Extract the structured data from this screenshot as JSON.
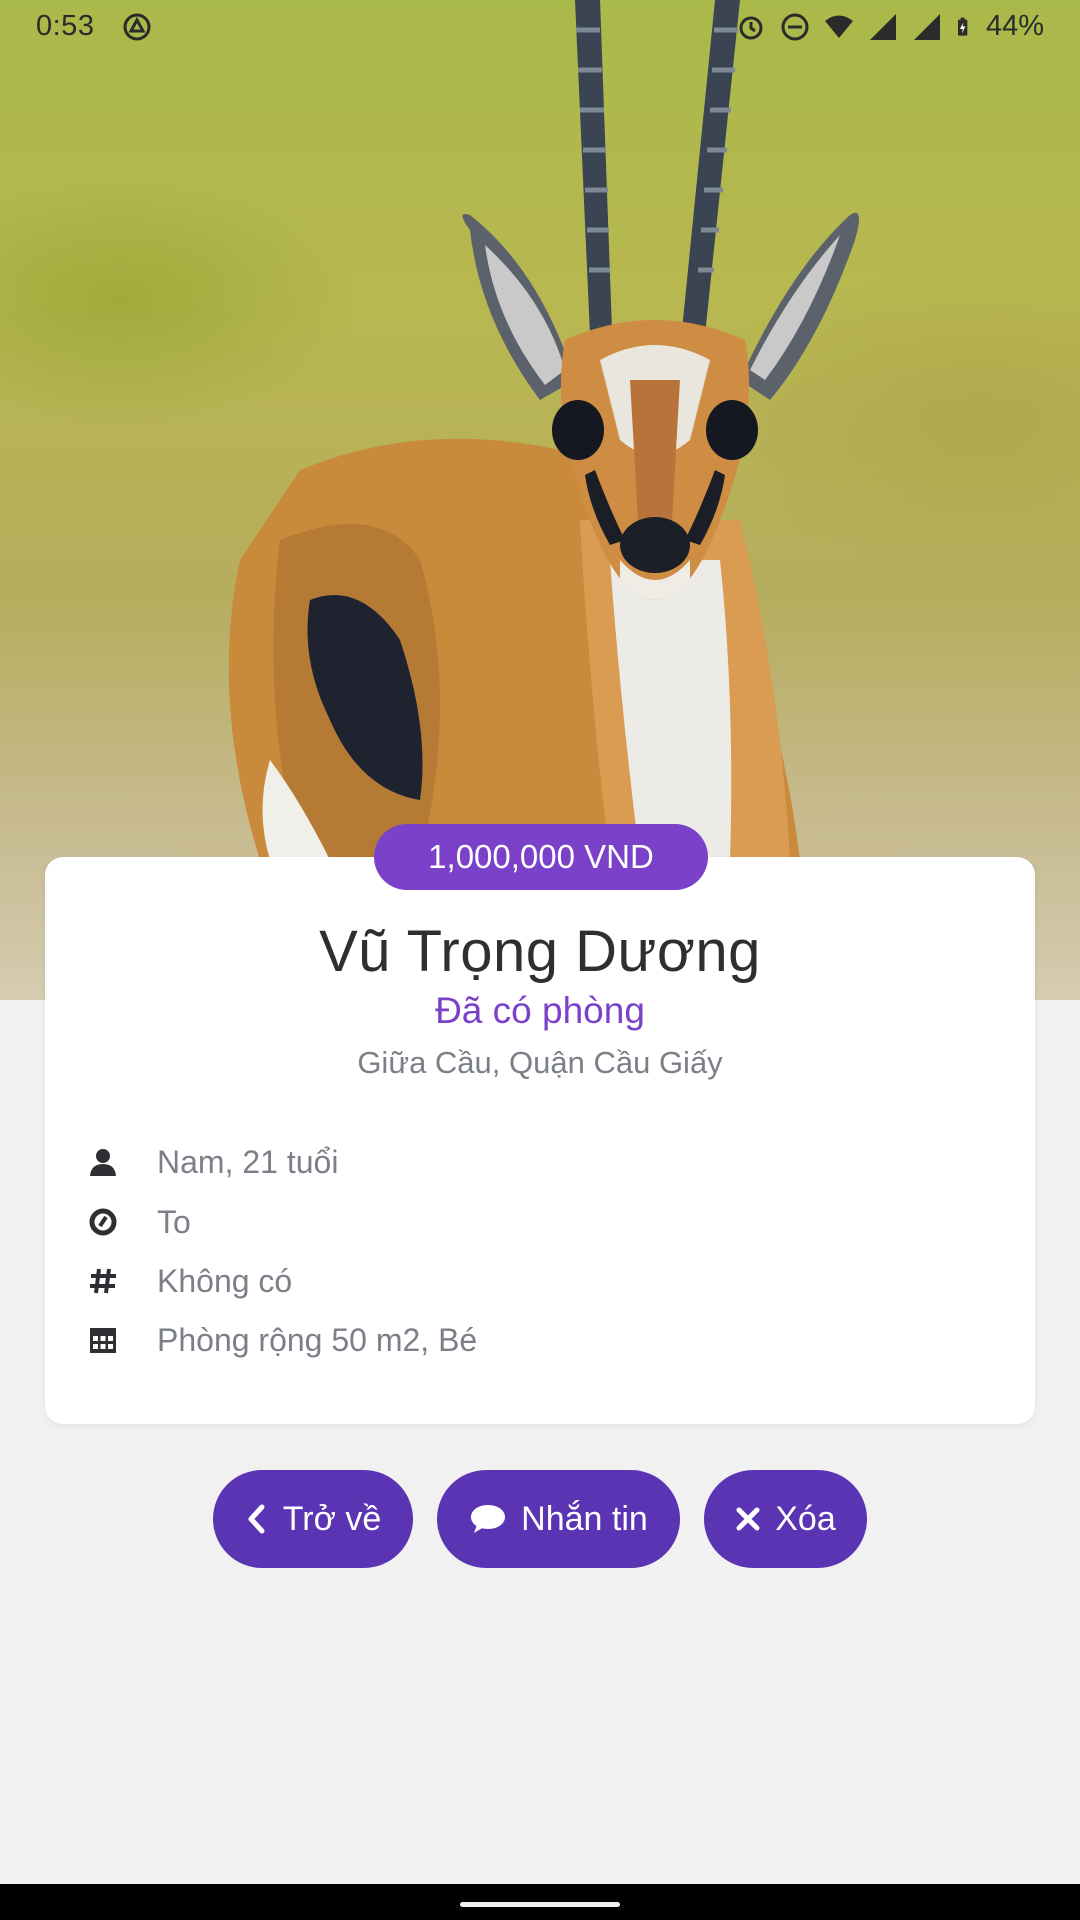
{
  "status_bar": {
    "time": "0:53",
    "battery": "44%",
    "icons": [
      "dnd-sync-icon",
      "alarm-icon",
      "do-not-disturb-icon",
      "wifi-icon",
      "cell-signal-icon",
      "cell-signal-icon",
      "battery-charging-icon"
    ]
  },
  "hero": {
    "image_subject": "gazelle"
  },
  "listing": {
    "price": "1,000,000 VND",
    "name": "Vũ Trọng Dương",
    "status": "Đã có phòng",
    "location": "Giữa Cầu, Quận Cầu Giấy",
    "details": [
      {
        "icon": "person-icon",
        "text": "Nam, 21 tuổi"
      },
      {
        "icon": "ring-icon",
        "text": "To"
      },
      {
        "icon": "hash-icon",
        "text": "Không có"
      },
      {
        "icon": "calendar-icon",
        "text": "Phòng rộng 50 m2, Bé"
      }
    ]
  },
  "actions": {
    "back_label": "Trở về",
    "message_label": "Nhắn tin",
    "delete_label": "Xóa"
  },
  "colors": {
    "accent": "#7b41c9",
    "button": "#5b34b4",
    "background": "#f1f1f2",
    "secondary_text": "#7b7f88"
  }
}
